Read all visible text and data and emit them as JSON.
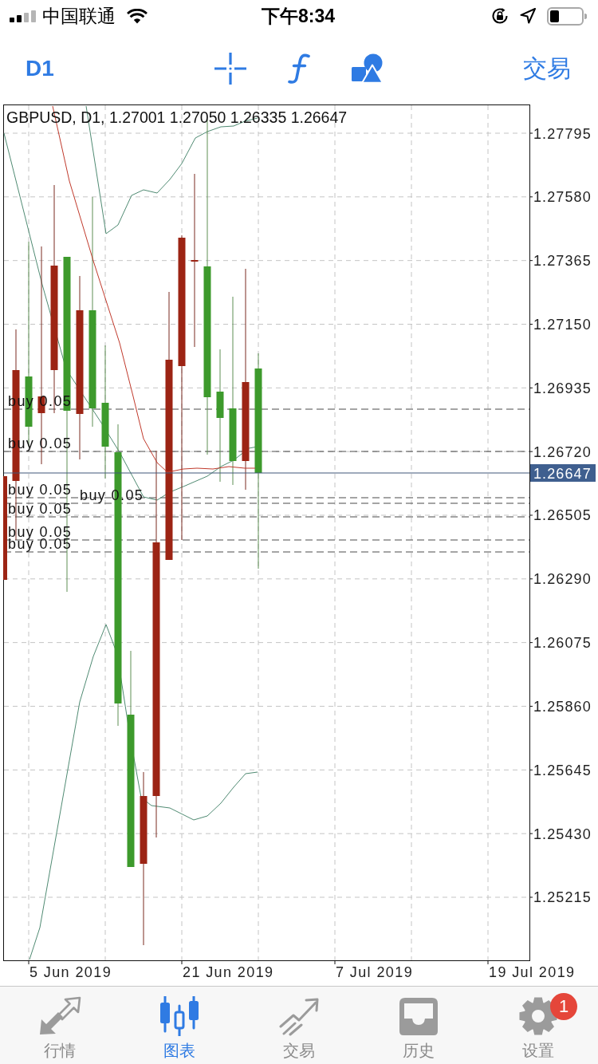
{
  "status_bar": {
    "carrier": "中国联通",
    "time": "下午8:34"
  },
  "toolbar": {
    "timeframe": "D1",
    "trade": "交易"
  },
  "chart": {
    "header": "GBPUSD, D1, 1.27001 1.27050 1.26335 1.26647",
    "price_ticks": [
      "1.27795",
      "1.27580",
      "1.27365",
      "1.27150",
      "1.26935",
      "1.26720",
      "1.26505",
      "1.26290",
      "1.26075",
      "1.25860",
      "1.25645",
      "1.25430",
      "1.25215"
    ],
    "current_price": "1.26647",
    "date_ticks": [
      "5 Jun 2019",
      "21 Jun 2019",
      "7 Jul 2019",
      "19 Jul 2019"
    ],
    "orders": [
      {
        "label": "buy 0.05"
      },
      {
        "label": "buy 0.05"
      },
      {
        "label": "buy 0.05"
      },
      {
        "label": "buy 0.05"
      },
      {
        "label": "buy 0.05"
      },
      {
        "label": "buy 0.05"
      },
      {
        "label": "buy 0.05"
      }
    ]
  },
  "tab_bar": [
    {
      "label": "行情",
      "selected": false
    },
    {
      "label": "图表",
      "selected": true
    },
    {
      "label": "交易",
      "selected": false
    },
    {
      "label": "历史",
      "selected": false
    },
    {
      "label": "设置",
      "selected": false,
      "badge": "1"
    }
  ]
}
